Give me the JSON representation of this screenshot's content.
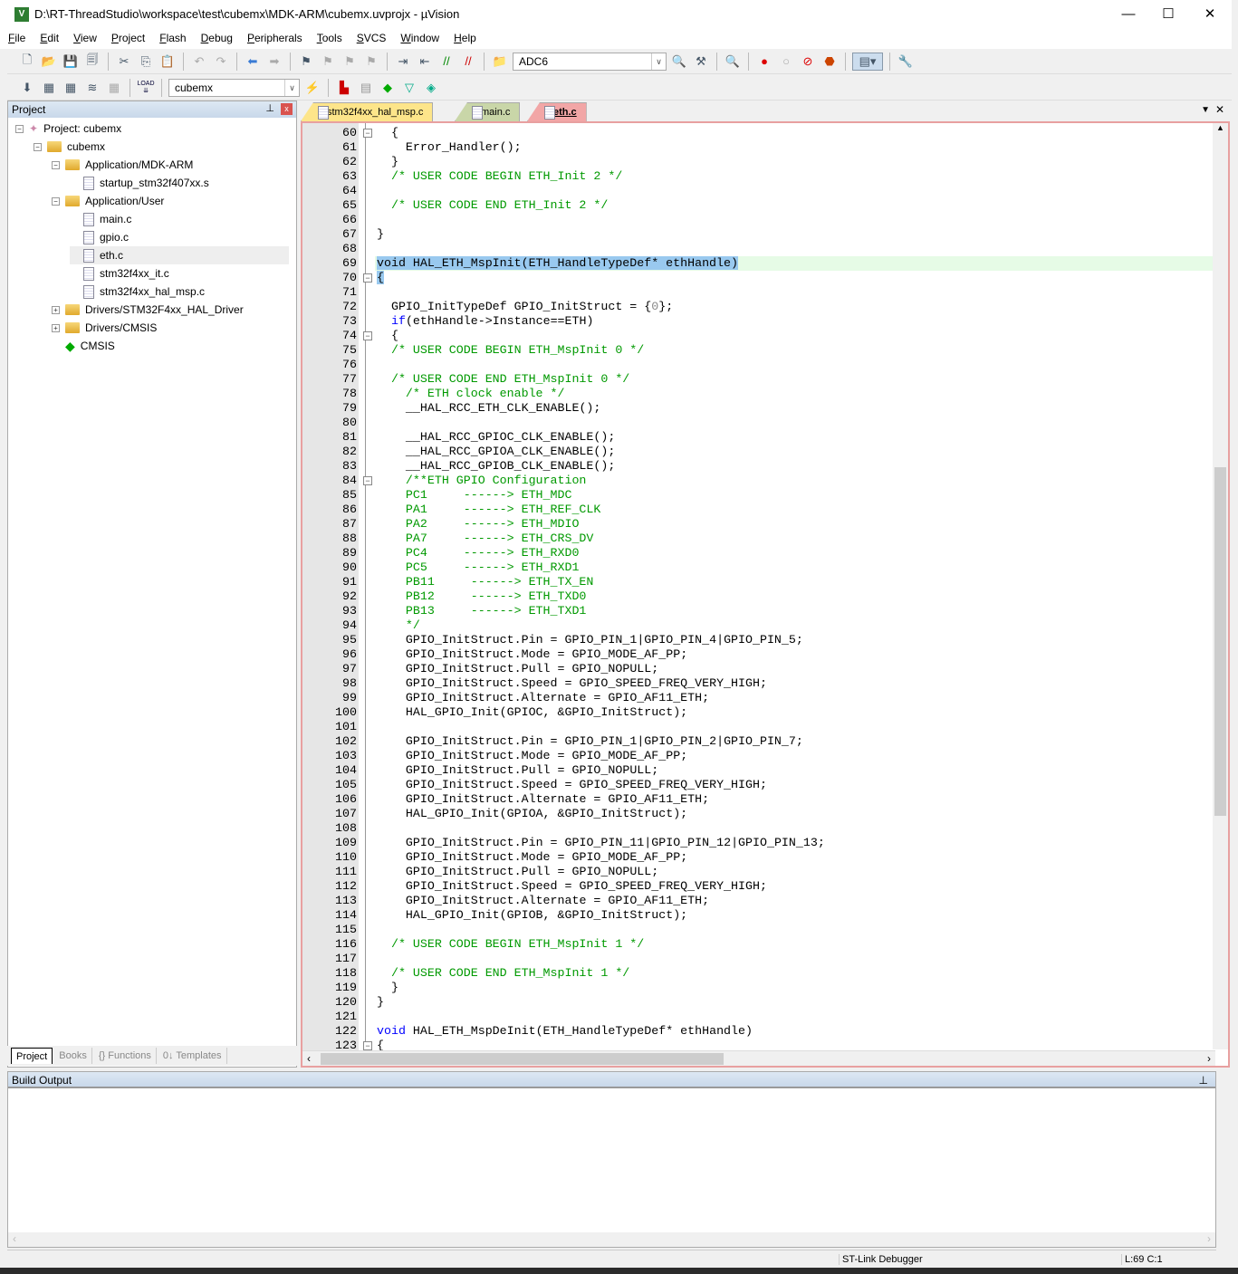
{
  "window": {
    "title": "D:\\RT-ThreadStudio\\workspace\\test\\cubemx\\MDK-ARM\\cubemx.uvprojx - µVision",
    "app_icon": "uvision-logo",
    "minimize": "—",
    "maximize": "☐",
    "close": "✕"
  },
  "menu": [
    "File",
    "Edit",
    "View",
    "Project",
    "Flash",
    "Debug",
    "Peripherals",
    "Tools",
    "SVCS",
    "Window",
    "Help"
  ],
  "toolbar1": {
    "find_combo": "ADC6"
  },
  "toolbar2": {
    "target_combo": "cubemx",
    "load_label": "LOAD"
  },
  "project_panel": {
    "title": "Project",
    "pin": "⊥",
    "close": "x",
    "tree": [
      {
        "label": "Project: cubemx",
        "level": 0,
        "icon": "project-icon",
        "toggle": "−"
      },
      {
        "label": "cubemx",
        "level": 1,
        "icon": "target-folder-icon",
        "toggle": "−"
      },
      {
        "label": "Application/MDK-ARM",
        "level": 2,
        "icon": "folder-icon",
        "toggle": "−"
      },
      {
        "label": "startup_stm32f407xx.s",
        "level": 3,
        "icon": "file-icon"
      },
      {
        "label": "Application/User",
        "level": 2,
        "icon": "folder-icon",
        "toggle": "−"
      },
      {
        "label": "main.c",
        "level": 3,
        "icon": "file-icon"
      },
      {
        "label": "gpio.c",
        "level": 3,
        "icon": "file-icon"
      },
      {
        "label": "eth.c",
        "level": 3,
        "icon": "file-icon",
        "selected": true
      },
      {
        "label": "stm32f4xx_it.c",
        "level": 3,
        "icon": "file-icon"
      },
      {
        "label": "stm32f4xx_hal_msp.c",
        "level": 3,
        "icon": "file-icon"
      },
      {
        "label": "Drivers/STM32F4xx_HAL_Driver",
        "level": 2,
        "icon": "folder-icon",
        "toggle": "+"
      },
      {
        "label": "Drivers/CMSIS",
        "level": 2,
        "icon": "folder-icon",
        "toggle": "+"
      },
      {
        "label": "CMSIS",
        "level": 2,
        "icon": "cmsis-gem-icon"
      }
    ],
    "tabs": [
      "Project",
      "Books",
      "{} Functions",
      "0↓ Templates"
    ]
  },
  "editor": {
    "tabs": [
      {
        "label": "stm32f4xx_hal_msp.c",
        "color": "#fde58a"
      },
      {
        "label": "main.c",
        "color": "#c9d6a8"
      },
      {
        "label": "eth.c",
        "color": "#f2a6a6",
        "active": true
      }
    ],
    "current_line": 69,
    "lines": [
      [
        60,
        "  {",
        "fold"
      ],
      [
        61,
        "    Error_Handler();"
      ],
      [
        62,
        "  }"
      ],
      [
        63,
        "  /* USER CODE BEGIN ETH_Init 2 */"
      ],
      [
        64,
        ""
      ],
      [
        65,
        "  /* USER CODE END ETH_Init 2 */"
      ],
      [
        66,
        ""
      ],
      [
        67,
        "}"
      ],
      [
        68,
        ""
      ],
      [
        69,
        "void HAL_ETH_MspInit(ETH_HandleTypeDef* ethHandle)"
      ],
      [
        70,
        "{",
        "fold"
      ],
      [
        71,
        ""
      ],
      [
        72,
        "  GPIO_InitTypeDef GPIO_InitStruct = {0};"
      ],
      [
        73,
        "  if(ethHandle->Instance==ETH)"
      ],
      [
        74,
        "  {",
        "fold"
      ],
      [
        75,
        "  /* USER CODE BEGIN ETH_MspInit 0 */"
      ],
      [
        76,
        ""
      ],
      [
        77,
        "  /* USER CODE END ETH_MspInit 0 */"
      ],
      [
        78,
        "    /* ETH clock enable */"
      ],
      [
        79,
        "    __HAL_RCC_ETH_CLK_ENABLE();"
      ],
      [
        80,
        ""
      ],
      [
        81,
        "    __HAL_RCC_GPIOC_CLK_ENABLE();"
      ],
      [
        82,
        "    __HAL_RCC_GPIOA_CLK_ENABLE();"
      ],
      [
        83,
        "    __HAL_RCC_GPIOB_CLK_ENABLE();"
      ],
      [
        84,
        "    /**ETH GPIO Configuration",
        "fold"
      ],
      [
        85,
        "    PC1     ------> ETH_MDC"
      ],
      [
        86,
        "    PA1     ------> ETH_REF_CLK"
      ],
      [
        87,
        "    PA2     ------> ETH_MDIO"
      ],
      [
        88,
        "    PA7     ------> ETH_CRS_DV"
      ],
      [
        89,
        "    PC4     ------> ETH_RXD0"
      ],
      [
        90,
        "    PC5     ------> ETH_RXD1"
      ],
      [
        91,
        "    PB11     ------> ETH_TX_EN"
      ],
      [
        92,
        "    PB12     ------> ETH_TXD0"
      ],
      [
        93,
        "    PB13     ------> ETH_TXD1"
      ],
      [
        94,
        "    */"
      ],
      [
        95,
        "    GPIO_InitStruct.Pin = GPIO_PIN_1|GPIO_PIN_4|GPIO_PIN_5;"
      ],
      [
        96,
        "    GPIO_InitStruct.Mode = GPIO_MODE_AF_PP;"
      ],
      [
        97,
        "    GPIO_InitStruct.Pull = GPIO_NOPULL;"
      ],
      [
        98,
        "    GPIO_InitStruct.Speed = GPIO_SPEED_FREQ_VERY_HIGH;"
      ],
      [
        99,
        "    GPIO_InitStruct.Alternate = GPIO_AF11_ETH;"
      ],
      [
        100,
        "    HAL_GPIO_Init(GPIOC, &GPIO_InitStruct);"
      ],
      [
        101,
        ""
      ],
      [
        102,
        "    GPIO_InitStruct.Pin = GPIO_PIN_1|GPIO_PIN_2|GPIO_PIN_7;"
      ],
      [
        103,
        "    GPIO_InitStruct.Mode = GPIO_MODE_AF_PP;"
      ],
      [
        104,
        "    GPIO_InitStruct.Pull = GPIO_NOPULL;"
      ],
      [
        105,
        "    GPIO_InitStruct.Speed = GPIO_SPEED_FREQ_VERY_HIGH;"
      ],
      [
        106,
        "    GPIO_InitStruct.Alternate = GPIO_AF11_ETH;"
      ],
      [
        107,
        "    HAL_GPIO_Init(GPIOA, &GPIO_InitStruct);"
      ],
      [
        108,
        ""
      ],
      [
        109,
        "    GPIO_InitStruct.Pin = GPIO_PIN_11|GPIO_PIN_12|GPIO_PIN_13;"
      ],
      [
        110,
        "    GPIO_InitStruct.Mode = GPIO_MODE_AF_PP;"
      ],
      [
        111,
        "    GPIO_InitStruct.Pull = GPIO_NOPULL;"
      ],
      [
        112,
        "    GPIO_InitStruct.Speed = GPIO_SPEED_FREQ_VERY_HIGH;"
      ],
      [
        113,
        "    GPIO_InitStruct.Alternate = GPIO_AF11_ETH;"
      ],
      [
        114,
        "    HAL_GPIO_Init(GPIOB, &GPIO_InitStruct);"
      ],
      [
        115,
        ""
      ],
      [
        116,
        "  /* USER CODE BEGIN ETH_MspInit 1 */"
      ],
      [
        117,
        ""
      ],
      [
        118,
        "  /* USER CODE END ETH_MspInit 1 */"
      ],
      [
        119,
        "  }"
      ],
      [
        120,
        "}"
      ],
      [
        121,
        ""
      ],
      [
        122,
        "void HAL_ETH_MspDeInit(ETH_HandleTypeDef* ethHandle)"
      ],
      [
        123,
        "{",
        "fold"
      ]
    ]
  },
  "build_output": {
    "title": "Build Output",
    "pin": "⊥"
  },
  "status": {
    "debugger": "ST-Link Debugger",
    "position": "L:69 C:1"
  }
}
